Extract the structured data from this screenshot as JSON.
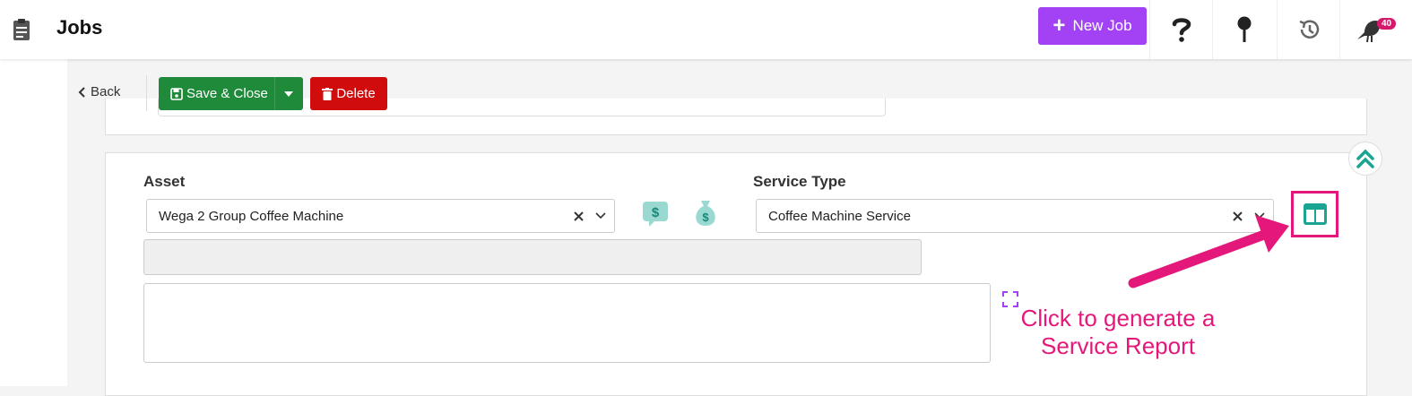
{
  "header": {
    "title": "Jobs",
    "new_job_label": "New Job",
    "notification_count": "40"
  },
  "toolbar": {
    "back_label": "Back",
    "save_close_label": "Save & Close",
    "delete_label": "Delete"
  },
  "form": {
    "asset_label": "Asset",
    "asset_value": "Wega 2 Group Coffee Machine",
    "service_type_label": "Service Type",
    "service_type_value": "Coffee Machine Service"
  },
  "annotation": {
    "line1": "Click to generate a",
    "line2": "Service Report"
  },
  "colors": {
    "accent_purple": "#a342f5",
    "save_green": "#1f8a3a",
    "delete_red": "#d00c0c",
    "teal_icon": "#26b3a3",
    "annotation_pink": "#e4187a"
  },
  "icons": {
    "logo": "clipboard-icon",
    "help": "question-icon",
    "pin": "map-pin-icon",
    "history": "history-icon",
    "bird": "bird-icon",
    "price_chat": "dollar-chat-icon",
    "money_bag": "money-bag-icon",
    "report": "service-report-icon",
    "collapse": "double-chevron-up-icon"
  }
}
